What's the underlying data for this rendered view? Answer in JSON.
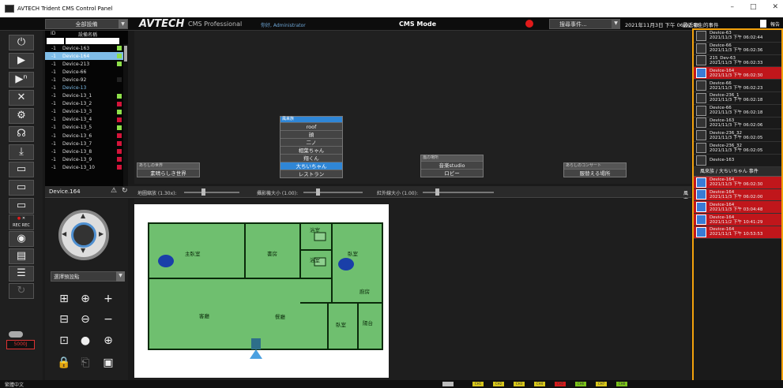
{
  "window": {
    "title": "AVTECH Trident CMS Control Panel",
    "min": "–",
    "max": "□",
    "close": "✕"
  },
  "top": {
    "group": "全部設備",
    "logo": "AVTECH",
    "product": "CMS Professional",
    "hello": "你好,",
    "user": "Administrator",
    "mode": "CMS Mode",
    "event_select": "搜尋事件...",
    "datetime": "2021年11月3日 下午 06:02:48",
    "event_title": "最近發生的事件",
    "report": "報告"
  },
  "devlist": {
    "header_id": "ID",
    "header_name": "設備名稱",
    "rows": [
      {
        "id": "-1",
        "name": "Device-163",
        "st": "#8ee04a"
      },
      {
        "id": "-1",
        "name": "Device-164",
        "st": "#8ee04a",
        "sel": true
      },
      {
        "id": "-1",
        "name": "Device-213",
        "st": "#8ee04a"
      },
      {
        "id": "-1",
        "name": "Device-66",
        "st": ""
      },
      {
        "id": "-1",
        "name": "Device-92",
        "st": "#222"
      },
      {
        "id": "-1",
        "name": "Device-13",
        "st": "",
        "cur": true
      },
      {
        "id": "-1",
        "name": "Device-13_1",
        "st": "#8ee04a"
      },
      {
        "id": "-1",
        "name": "Device-13_2",
        "st": "#d4143a"
      },
      {
        "id": "-1",
        "name": "Device-13_3",
        "st": "#8ee04a"
      },
      {
        "id": "-1",
        "name": "Device-13_4",
        "st": "#d4143a"
      },
      {
        "id": "-1",
        "name": "Device-13_5",
        "st": "#8ee04a"
      },
      {
        "id": "-1",
        "name": "Device-13_6",
        "st": "#d4143a"
      },
      {
        "id": "-1",
        "name": "Device-13_7",
        "st": "#d4143a"
      },
      {
        "id": "-1",
        "name": "Device-13_8",
        "st": "#d4143a"
      },
      {
        "id": "-1",
        "name": "Device-13_9",
        "st": "#d4143a"
      },
      {
        "id": "-1",
        "name": "Device-13_10",
        "st": "#d4143a"
      }
    ]
  },
  "map": {
    "box1": {
      "head": "あらしの世界",
      "item": "素晴らしき世界"
    },
    "box2": {
      "head": "風来族",
      "items": [
        "roof",
        "顔",
        "二ノ",
        "相葉ちゃん",
        "翔くん",
        "大ちいちゃん",
        "レストラン"
      ],
      "selected": 5
    },
    "box3": {
      "head": "嵐の場所",
      "items": [
        "音楽studio",
        "ロビー"
      ]
    },
    "box4": {
      "head": "あらしのコンサート",
      "item": "服替える場所"
    }
  },
  "panelbar": {
    "device": "Device.164",
    "s1": "地圖縮放 (1.30x):",
    "s2": "攝影機大小 (1.00):",
    "s3": "紅外線大小 (1.00):",
    "path": "風來族 / 大ちいちゃん"
  },
  "ptz": {
    "preset": "選擇預設點"
  },
  "floor": {
    "rooms": [
      "主臥室",
      "書房",
      "浴室",
      "浴室",
      "臥室",
      "廚房",
      "客廳",
      "餐廳",
      "臥室",
      "陽台"
    ]
  },
  "left": {
    "rec": "REC",
    "counter": "5000J"
  },
  "events": [
    {
      "dev": "Device-63",
      "time": "2021/11/3 下午 06:02:44",
      "red": false
    },
    {
      "dev": "Device-66",
      "time": "2021/11/3 下午 06:02:36",
      "red": false
    },
    {
      "dev": "215_Dev-63",
      "time": "2021/11/3 下午 06:02:33",
      "red": false
    },
    {
      "dev": "Device-164",
      "time": "2021/11/3 下午 06:02:30",
      "red": true
    },
    {
      "dev": "Device-66",
      "time": "2021/11/3 下午 06:02:23",
      "red": false
    },
    {
      "dev": "Device-236_1",
      "time": "2021/11/3 下午 06:02:18",
      "red": false
    },
    {
      "dev": "Device-66",
      "time": "2021/11/3 下午 06:02:18",
      "red": false
    },
    {
      "dev": "Device-163",
      "time": "2021/11/3 下午 06:02:06",
      "red": false
    },
    {
      "dev": "Device-236_32",
      "time": "2021/11/3 下午 06:02:05",
      "red": false
    },
    {
      "dev": "Device-236_32",
      "time": "2021/11/3 下午 06:02:05",
      "red": false
    },
    {
      "dev": "Device-163",
      "time": "",
      "red": false
    }
  ],
  "events_sep": "風來族 / 大ちいちゃん 事件",
  "events2": [
    {
      "dev": "Device-164",
      "time": "2021/11/3 下午 06:02:30"
    },
    {
      "dev": "Device-164",
      "time": "2021/11/3 下午 06:02:00"
    },
    {
      "dev": "Device-164",
      "time": "2021/11/3 下午 03:04:48"
    },
    {
      "dev": "Device-164",
      "time": "2021/11/2 下午 10:41:29"
    },
    {
      "dev": "Device-164",
      "time": "2021/11/1 下午 10:53:53"
    }
  ],
  "bottom": {
    "lang": "繁體中文",
    "tags": [
      "CH1",
      "CH2",
      "CH3",
      "CH4",
      "CH5",
      "CH6",
      "CH7",
      "CH8"
    ]
  }
}
